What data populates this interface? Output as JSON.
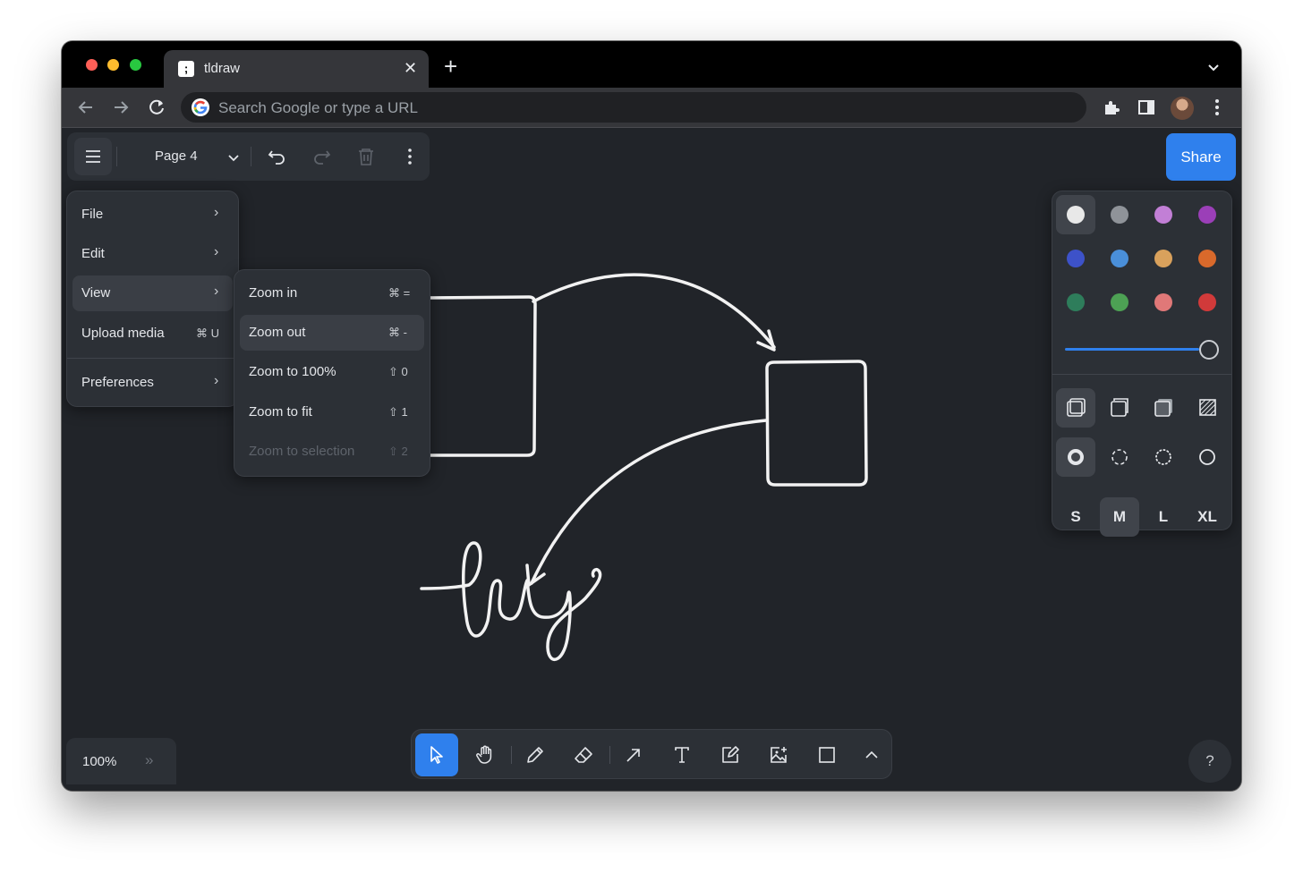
{
  "browser": {
    "tab": {
      "favicon": ";",
      "title": "tldraw"
    },
    "omnibox": {
      "placeholder": "Search Google or type a URL"
    }
  },
  "app": {
    "top_bar": {
      "page_name": "Page 4"
    },
    "share_button": {
      "label": "Share"
    },
    "main_menu": {
      "items": [
        {
          "label": "File",
          "shortcut": "",
          "has_submenu": true
        },
        {
          "label": "Edit",
          "shortcut": "",
          "has_submenu": true
        },
        {
          "label": "View",
          "shortcut": "",
          "has_submenu": true
        },
        {
          "label": "Upload media",
          "shortcut": "⌘ U",
          "has_submenu": false
        },
        {
          "label": "Preferences",
          "shortcut": "",
          "has_submenu": true
        }
      ]
    },
    "view_submenu": {
      "items": [
        {
          "label": "Zoom in",
          "shortcut": "⌘ =",
          "state": "normal"
        },
        {
          "label": "Zoom out",
          "shortcut": "⌘ -",
          "state": "highlighted"
        },
        {
          "label": "Zoom to 100%",
          "shortcut": "⇧ 0",
          "state": "normal"
        },
        {
          "label": "Zoom to fit",
          "shortcut": "⇧ 1",
          "state": "normal"
        },
        {
          "label": "Zoom to selection",
          "shortcut": "⇧ 2",
          "state": "disabled"
        }
      ]
    },
    "style_panel": {
      "colors": [
        "#e8e8e8",
        "#8f9399",
        "#c27fd6",
        "#9b3fb8",
        "#3d52c9",
        "#4a8fd9",
        "#d9a15c",
        "#d9692b",
        "#2e7d5b",
        "#4da154",
        "#e07878",
        "#d13a3a"
      ],
      "selected_color_index": 0,
      "opacity": 1.0,
      "fill_styles": [
        "none",
        "semi",
        "solid",
        "pattern"
      ],
      "selected_fill_index": 0,
      "dash_styles": [
        "draw",
        "dashed",
        "dotted",
        "solid"
      ],
      "selected_dash_index": 0,
      "sizes": [
        "S",
        "M",
        "L",
        "XL"
      ],
      "selected_size_index": 1
    },
    "zoom": {
      "label": "100%",
      "expand_glyph": "»"
    },
    "help": {
      "label": "?"
    },
    "tools": [
      "select",
      "hand",
      "draw",
      "eraser",
      "arrow",
      "text",
      "note",
      "media",
      "rectangle",
      "more"
    ],
    "selected_tool": "select"
  }
}
